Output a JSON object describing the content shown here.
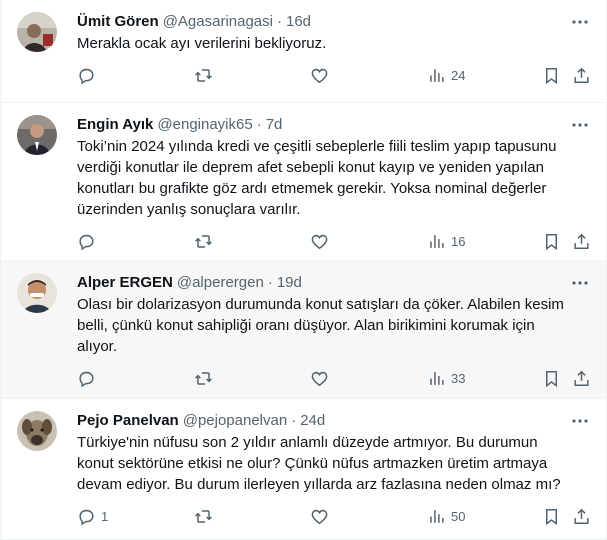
{
  "tweets": [
    {
      "name": "Ümit Gören",
      "handle": "@Agasarinagasi",
      "sep": "·",
      "time": "16d",
      "text": "Merakla ocak ayı verilerini bekliyoruz.",
      "replies": "",
      "reposts": "",
      "likes": "",
      "views": "24"
    },
    {
      "name": "Engin Ayık",
      "handle": "@enginayik65",
      "sep": "·",
      "time": "7d",
      "text": "Toki’nin 2024 yılında kredi ve çeşitli sebeplerle fiili teslim yapıp tapusunu verdiği konutlar ile deprem afet sebepli konut kayıp ve yeniden yapılan konutları bu grafikte göz ardı etmemek gerekir. Yoksa nominal değerler üzerinden yanlış sonuçlara varılır.",
      "replies": "",
      "reposts": "",
      "likes": "",
      "views": "16"
    },
    {
      "name": "Alper ERGEN",
      "handle": "@alperergen",
      "sep": "·",
      "time": "19d",
      "text": "Olası bir dolarizasyon durumunda konut satışları da çöker. Alabilen kesim belli, çünkü konut sahipliği oranı düşüyor. Alan birikimini korumak için alıyor.",
      "replies": "",
      "reposts": "",
      "likes": "",
      "views": "33"
    },
    {
      "name": "Pejo Panelvan",
      "handle": "@pejopanelvan",
      "sep": "·",
      "time": "24d",
      "text": "Türkiye'nin nüfusu son 2 yıldır anlamlı düzeyde artmıyor. Bu durumun konut sektörüne etkisi ne olur? Çünkü nüfus artmazken üretim artmaya devam ediyor. Bu durum ilerleyen yıllarda arz fazlasına neden olmaz mı?",
      "replies": "1",
      "reposts": "",
      "likes": "",
      "views": "50"
    }
  ],
  "icons": {
    "more": "more-horizontal-icon",
    "reply": "reply-icon",
    "repost": "repost-icon",
    "like": "like-icon",
    "views": "views-icon",
    "bookmark": "bookmark-icon",
    "share": "share-icon"
  },
  "colors": {
    "text": "#0f1419",
    "secondary": "#536471",
    "divider": "#eff3f4",
    "hover_bg": "#f7f7f7"
  }
}
